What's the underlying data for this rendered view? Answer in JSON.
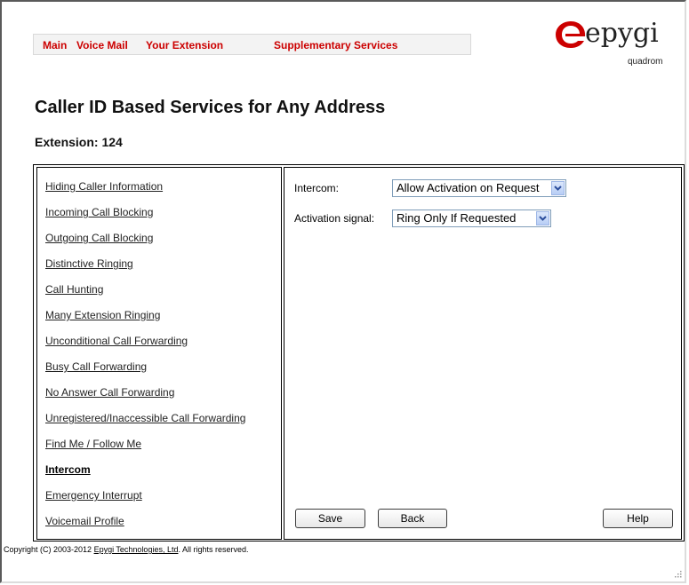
{
  "nav": {
    "items": [
      "Main",
      "Voice Mail",
      "Your Extension",
      "Supplementary Services"
    ]
  },
  "logo": {
    "brand": "epygi",
    "product": "quadrom"
  },
  "page": {
    "title": "Caller ID Based Services for Any Address",
    "extension_label": "Extension: 124"
  },
  "sidebar": {
    "items": [
      {
        "label": "Hiding Caller Information",
        "active": false
      },
      {
        "label": "Incoming Call Blocking",
        "active": false
      },
      {
        "label": "Outgoing Call Blocking",
        "active": false
      },
      {
        "label": "Distinctive Ringing",
        "active": false
      },
      {
        "label": "Call Hunting",
        "active": false
      },
      {
        "label": "Many Extension Ringing",
        "active": false
      },
      {
        "label": "Unconditional Call Forwarding",
        "active": false
      },
      {
        "label": "Busy Call Forwarding",
        "active": false
      },
      {
        "label": "No Answer Call Forwarding",
        "active": false
      },
      {
        "label": "Unregistered/Inaccessible Call Forwarding",
        "active": false
      },
      {
        "label": "Find Me / Follow Me",
        "active": false
      },
      {
        "label": "Intercom",
        "active": true
      },
      {
        "label": "Emergency Interrupt",
        "active": false
      },
      {
        "label": "Voicemail Profile",
        "active": false
      }
    ]
  },
  "form": {
    "intercom_label": "Intercom:",
    "intercom_value": "Allow Activation on Request",
    "signal_label": "Activation signal:",
    "signal_value": "Ring Only If Requested"
  },
  "buttons": {
    "save": "Save",
    "back": "Back",
    "help": "Help"
  },
  "footer": {
    "prefix": "Copyright (C) 2003-2012 ",
    "link": "Epygi Technologies, Ltd",
    "suffix": ". All rights reserved."
  },
  "colors": {
    "nav_text": "#cc0000",
    "logo_red": "#cc0000"
  }
}
